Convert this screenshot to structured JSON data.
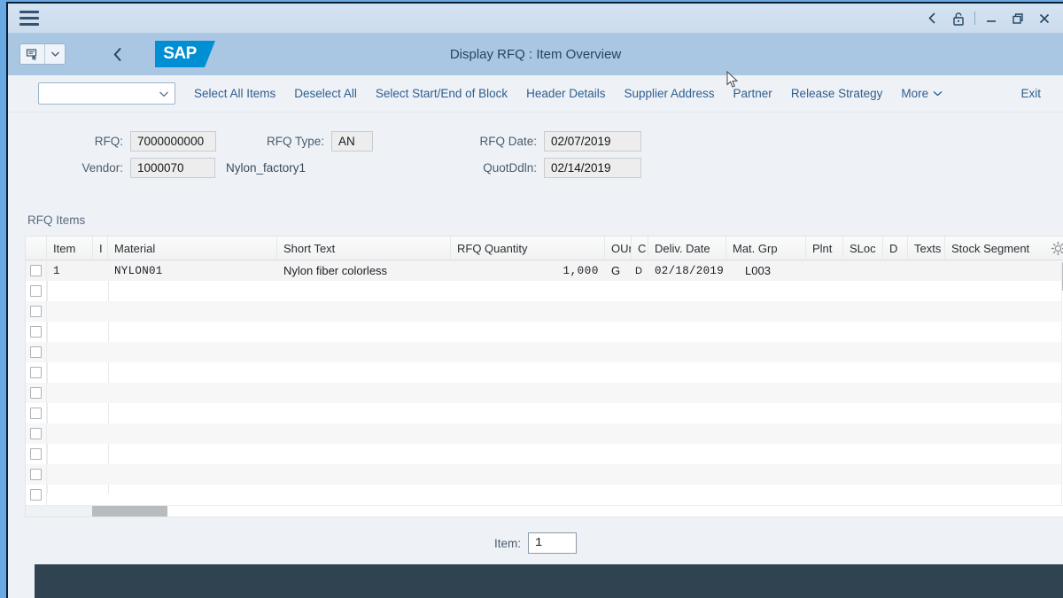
{
  "window": {
    "menu_icon": "hamburger-icon",
    "controls": [
      "back-chevron-icon",
      "lock-icon",
      "minimize-icon",
      "restore-icon",
      "close-icon"
    ]
  },
  "shell": {
    "title": "Display RFQ : Item Overview",
    "logo_text": "SAP",
    "nav_back_icon": "chevron-left-icon",
    "split_button_icon": "note-with-cursor-icon",
    "split_button_arrow_icon": "chevron-down-icon"
  },
  "toolbar": {
    "select_value": "",
    "select_icon": "chevron-down-icon",
    "actions": [
      "Select All Items",
      "Deselect All",
      "Select Start/End of Block",
      "Header Details",
      "Supplier Address",
      "Partner",
      "Release Strategy"
    ],
    "more_label": "More",
    "more_icon": "chevron-down-icon",
    "exit_label": "Exit"
  },
  "form": {
    "rfq_label": "RFQ:",
    "rfq_value": "7000000000",
    "rfq_type_label": "RFQ Type:",
    "rfq_type_value": "AN",
    "rfq_date_label": "RFQ Date:",
    "rfq_date_value": "02/07/2019",
    "vendor_label": "Vendor:",
    "vendor_value": "1000070",
    "vendor_name": "Nylon_factory1",
    "quotddln_label": "QuotDdln:",
    "quotddln_value": "02/14/2019"
  },
  "table": {
    "section_title": "RFQ Items",
    "settings_icon": "gear-icon",
    "columns": [
      "Item",
      "I",
      "Material",
      "Short Text",
      "RFQ Quantity",
      "OUn",
      "C",
      "Deliv. Date",
      "Mat. Grp",
      "Plnt",
      "SLoc",
      "D",
      "Texts",
      "Stock Segment"
    ],
    "rows": [
      {
        "item": "1",
        "i": "",
        "material": "NYLON01",
        "short_text": "Nylon fiber colorless",
        "rfq_quantity": "1,000",
        "oun": "G",
        "c": "D",
        "deliv_date": "02/18/2019",
        "mat_grp": "L003",
        "plnt": "",
        "sloc": "",
        "d": "",
        "texts": "",
        "stock_segment": ""
      }
    ],
    "empty_row_count": 11
  },
  "bottom": {
    "item_label": "Item:",
    "item_value": "1"
  },
  "colors": {
    "shell_blue": "#a9c7e3",
    "frame_blue": "#6aaae4",
    "link_blue": "#2e5e8e",
    "sap_logo_blue": "#008fd3",
    "footer_dark": "#2f4450",
    "page_bg": "#eef2f7"
  }
}
